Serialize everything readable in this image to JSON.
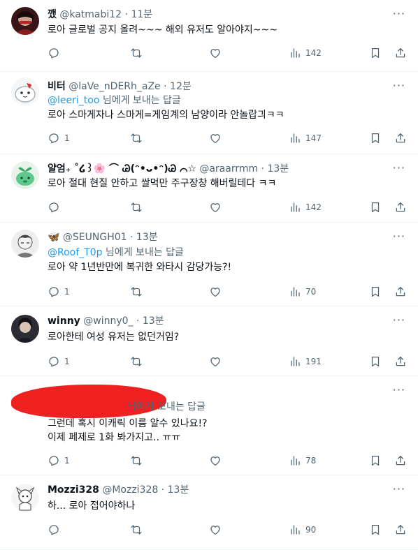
{
  "tweets": [
    {
      "name": "깼",
      "handle": "@katmabi12",
      "time": "11분",
      "reply_to": "",
      "reply_suffix": "",
      "lines": [
        "로아 글로벌 공지 올려~~~ 해외 유저도 알아야지~~~"
      ],
      "reply_count": "",
      "views": "142"
    },
    {
      "name": "비터",
      "handle": "@laVe_nDERh_aZe",
      "time": "12분",
      "reply_to": "@leeri_too",
      "reply_suffix": "님에게 보내는 답글",
      "lines": [
        "로아 스마게자나 스마게=게임계의 남양이라 안놀랍긔ㅋㅋ"
      ],
      "reply_count": "1",
      "views": "147"
    },
    {
      "name": "얄엄₊ ˚໒꒱🌸 ⌒ Ꮚ(ᵔ•ᴗ•ᵔ)Ꮚ ⌒☆",
      "handle": "@araarrmm",
      "time": "13분",
      "reply_to": "",
      "reply_suffix": "",
      "lines": [
        "로아 절대 현질 안하고 쌀먹만 주구장창 해버릴테다 ㅋㅋ"
      ],
      "reply_count": "",
      "views": "142"
    },
    {
      "name": "🦋",
      "handle": "@SEUNGH01",
      "time": "13분",
      "reply_to": "@Roof_T0p",
      "reply_suffix": "님에게 보내는 답글",
      "lines": [
        "로아 약 1년반만에 복귀한 와타시 감당가능?!"
      ],
      "reply_count": "1",
      "views": "70"
    },
    {
      "name": "winny",
      "handle": "@winny0_",
      "time": "13분",
      "reply_to": "",
      "reply_suffix": "",
      "lines": [
        "로아한테 여성 유저는 없던거임?"
      ],
      "reply_count": "1",
      "views": "191"
    },
    {
      "name": "",
      "handle": "",
      "time": "",
      "reply_to": "",
      "reply_suffix": "님에게 보내는 답글",
      "lines": [
        "그런데 혹시 이캐릭 이름 알수 있나요!?",
        "이제 페제로 1화 봐가지고.. ㅠㅠ"
      ],
      "reply_count": "1",
      "views": "78"
    },
    {
      "name": "Mozzi328",
      "handle": "@Mozzi328",
      "time": "13분",
      "reply_to": "",
      "reply_suffix": "",
      "lines": [
        "하... 로아 접어야하나"
      ],
      "reply_count": "",
      "views": "90"
    }
  ],
  "ui": {
    "dot": "·",
    "more": "···"
  },
  "icons": [
    "reply-icon",
    "retweet-icon",
    "like-icon",
    "views-icon",
    "bookmark-icon",
    "share-icon"
  ],
  "colors": {
    "text": "#0f1419",
    "secondary": "#536471",
    "link": "#1d9bf0",
    "divider": "#eff3f4",
    "redaction": "#ee2020"
  }
}
